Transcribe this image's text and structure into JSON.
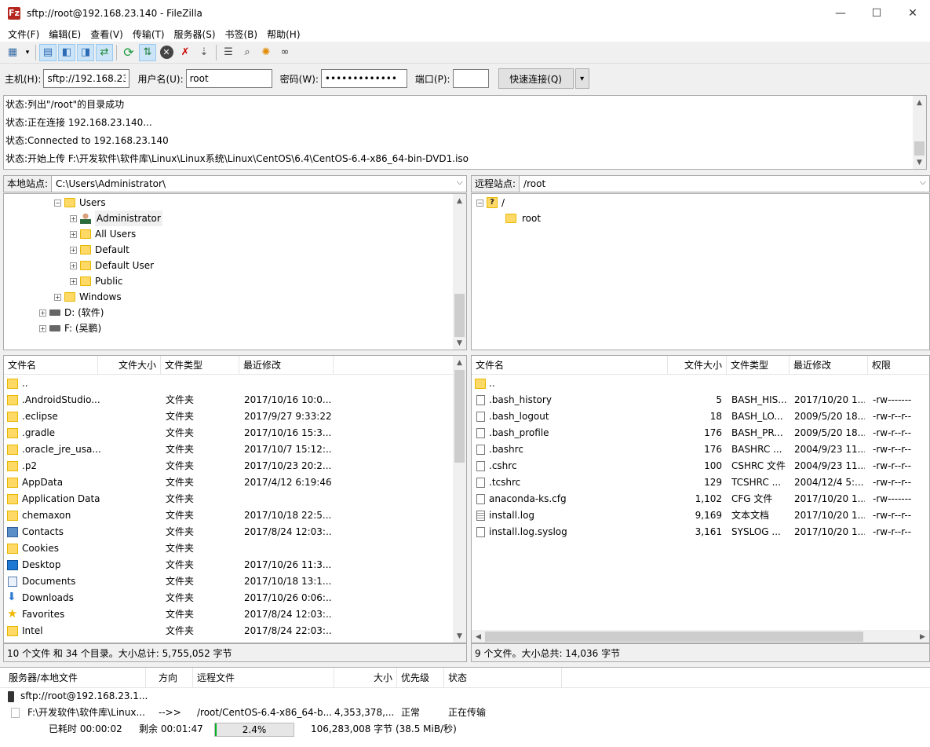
{
  "window": {
    "title": "sftp://root@192.168.23.140 - FileZilla",
    "app_icon": "Fz",
    "minimize": "—",
    "maximize": "☐",
    "close": "✕"
  },
  "menu": [
    "文件(F)",
    "编辑(E)",
    "查看(V)",
    "传输(T)",
    "服务器(S)",
    "书签(B)",
    "帮助(H)"
  ],
  "toolbar": [
    "site-manager-icon",
    "dropdown-arrow-icon",
    "toggle-log-icon",
    "toggle-local-tree-icon",
    "toggle-remote-tree-icon",
    "toggle-queue-icon",
    "refresh-icon",
    "process-queue-icon",
    "cancel-icon",
    "disconnect-icon",
    "reconnect-icon",
    "filter-icon",
    "compare-icon",
    "sync-browse-icon",
    "search-icon"
  ],
  "quickconnect": {
    "host_label": "主机(H):",
    "host_value": "sftp://192.168.23.",
    "user_label": "用户名(U):",
    "user_value": "root",
    "pass_label": "密码(W):",
    "pass_value": "•••••••••••••",
    "port_label": "端口(P):",
    "port_value": "",
    "connect_label": "快速连接(Q)",
    "dropdown": "▾"
  },
  "log": [
    "状态:列出\"/root\"的目录成功",
    "状态:正在连接 192.168.23.140...",
    "状态:Connected to 192.168.23.140",
    "状态:开始上传 F:\\开发软件\\软件库\\Linux\\Linux系统\\Linux\\CentOS\\6.4\\CentOS-6.4-x86_64-bin-DVD1.iso"
  ],
  "local": {
    "site_label": "本地站点:",
    "path": "C:\\Users\\Administrator\\",
    "tree": [
      {
        "label": "Users",
        "pm": "−",
        "icon": "folder"
      },
      {
        "label": "Administrator",
        "pm": "+",
        "icon": "user"
      },
      {
        "label": "All Users",
        "pm": "+",
        "icon": "folder"
      },
      {
        "label": "Default",
        "pm": "+",
        "icon": "folder"
      },
      {
        "label": "Default User",
        "pm": "+",
        "icon": "folder"
      },
      {
        "label": "Public",
        "pm": "+",
        "icon": "folder"
      },
      {
        "label": "Windows",
        "pm": "+",
        "icon": "folder"
      },
      {
        "label": "D: (软件)",
        "pm": "+",
        "icon": "drive"
      },
      {
        "label": "F: (吴鹏)",
        "pm": "+",
        "icon": "drive"
      }
    ],
    "columns": [
      "文件名",
      "文件大小",
      "文件类型",
      "最近修改"
    ],
    "files": [
      {
        "name": "..",
        "size": "",
        "type": "",
        "modified": "",
        "icon": "folder"
      },
      {
        "name": ".AndroidStudio...",
        "size": "",
        "type": "文件夹",
        "modified": "2017/10/16 10:0...",
        "icon": "folder"
      },
      {
        "name": ".eclipse",
        "size": "",
        "type": "文件夹",
        "modified": "2017/9/27 9:33:22",
        "icon": "folder"
      },
      {
        "name": ".gradle",
        "size": "",
        "type": "文件夹",
        "modified": "2017/10/16 15:3...",
        "icon": "folder"
      },
      {
        "name": ".oracle_jre_usa...",
        "size": "",
        "type": "文件夹",
        "modified": "2017/10/7 15:12:...",
        "icon": "folder"
      },
      {
        "name": ".p2",
        "size": "",
        "type": "文件夹",
        "modified": "2017/10/23 20:2...",
        "icon": "folder"
      },
      {
        "name": "AppData",
        "size": "",
        "type": "文件夹",
        "modified": "2017/4/12 6:19:46",
        "icon": "folder"
      },
      {
        "name": "Application Data",
        "size": "",
        "type": "文件夹",
        "modified": "",
        "icon": "folder"
      },
      {
        "name": "chemaxon",
        "size": "",
        "type": "文件夹",
        "modified": "2017/10/18 22:5...",
        "icon": "folder"
      },
      {
        "name": "Contacts",
        "size": "",
        "type": "文件夹",
        "modified": "2017/8/24 12:03:...",
        "icon": "contacts"
      },
      {
        "name": "Cookies",
        "size": "",
        "type": "文件夹",
        "modified": "",
        "icon": "folder"
      },
      {
        "name": "Desktop",
        "size": "",
        "type": "文件夹",
        "modified": "2017/10/26 11:3...",
        "icon": "desktop"
      },
      {
        "name": "Documents",
        "size": "",
        "type": "文件夹",
        "modified": "2017/10/18 13:1...",
        "icon": "documents"
      },
      {
        "name": "Downloads",
        "size": "",
        "type": "文件夹",
        "modified": "2017/10/26 0:06:...",
        "icon": "downloads"
      },
      {
        "name": "Favorites",
        "size": "",
        "type": "文件夹",
        "modified": "2017/8/24 12:03:...",
        "icon": "favorites"
      },
      {
        "name": "Intel",
        "size": "",
        "type": "文件夹",
        "modified": "2017/8/24 22:03:...",
        "icon": "folder"
      }
    ],
    "status": "10 个文件 和 34 个目录。大小总计: 5,755,052 字节"
  },
  "remote": {
    "site_label": "远程站点:",
    "path": "/root",
    "tree": [
      {
        "label": "/",
        "pm": "−",
        "icon": "question"
      },
      {
        "label": "root",
        "pm": "",
        "icon": "folder"
      }
    ],
    "columns": [
      "文件名",
      "文件大小",
      "文件类型",
      "最近修改",
      "权限"
    ],
    "files": [
      {
        "name": "..",
        "size": "",
        "type": "",
        "modified": "",
        "perm": "",
        "icon": "folder"
      },
      {
        "name": ".bash_history",
        "size": "5",
        "type": "BASH_HIS...",
        "modified": "2017/10/20 1...",
        "perm": "-rw-------",
        "icon": "file"
      },
      {
        "name": ".bash_logout",
        "size": "18",
        "type": "BASH_LO...",
        "modified": "2009/5/20 18...",
        "perm": "-rw-r--r--",
        "icon": "file"
      },
      {
        "name": ".bash_profile",
        "size": "176",
        "type": "BASH_PR...",
        "modified": "2009/5/20 18...",
        "perm": "-rw-r--r--",
        "icon": "file"
      },
      {
        "name": ".bashrc",
        "size": "176",
        "type": "BASHRC ...",
        "modified": "2004/9/23 11...",
        "perm": "-rw-r--r--",
        "icon": "file"
      },
      {
        "name": ".cshrc",
        "size": "100",
        "type": "CSHRC 文件",
        "modified": "2004/9/23 11...",
        "perm": "-rw-r--r--",
        "icon": "file"
      },
      {
        "name": ".tcshrc",
        "size": "129",
        "type": "TCSHRC ...",
        "modified": "2004/12/4 5:...",
        "perm": "-rw-r--r--",
        "icon": "file"
      },
      {
        "name": "anaconda-ks.cfg",
        "size": "1,102",
        "type": "CFG 文件",
        "modified": "2017/10/20 1...",
        "perm": "-rw-------",
        "icon": "file"
      },
      {
        "name": "install.log",
        "size": "9,169",
        "type": "文本文档",
        "modified": "2017/10/20 1...",
        "perm": "-rw-r--r--",
        "icon": "textfile"
      },
      {
        "name": "install.log.syslog",
        "size": "3,161",
        "type": "SYSLOG ...",
        "modified": "2017/10/20 1...",
        "perm": "-rw-r--r--",
        "icon": "file"
      }
    ],
    "status": "9 个文件。大小总共: 14,036 字节"
  },
  "queue": {
    "columns": [
      "服务器/本地文件",
      "方向",
      "远程文件",
      "大小",
      "优先级",
      "状态"
    ],
    "server": "sftp://root@192.168.23.1...",
    "local_file": "F:\\开发软件\\软件库\\Linux...",
    "direction": "-->>",
    "remote_file": "/root/CentOS-6.4-x86_64-b...",
    "size": "4,353,378,...",
    "priority": "正常",
    "status": "正在传输",
    "elapsed": "已耗时 00:00:02",
    "remaining": "剩余 00:01:47",
    "progress_text": "2.4%",
    "progress_fraction": 0.024,
    "transferred": "106,283,008 字节 (38.5 MiB/秒)"
  },
  "colors": {
    "progress": "#06b025",
    "folder": "#ffd966",
    "selection": "#cce4f7"
  }
}
